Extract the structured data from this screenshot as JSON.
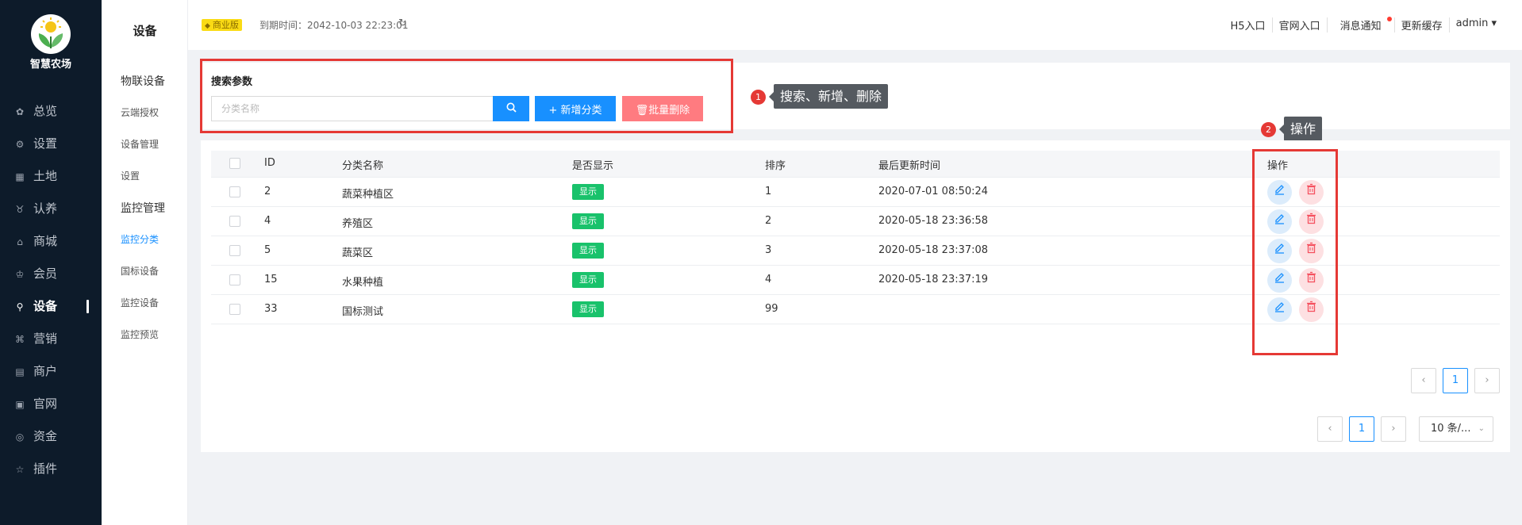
{
  "brand": {
    "name": "智慧农场"
  },
  "nav": [
    {
      "icon": "gear-flower-icon",
      "glyph": "✿",
      "label": "总览"
    },
    {
      "icon": "settings-icon",
      "glyph": "⚙",
      "label": "设置"
    },
    {
      "icon": "grid-icon",
      "glyph": "▦",
      "label": "土地"
    },
    {
      "icon": "adopt-icon",
      "glyph": "♉",
      "label": "认养"
    },
    {
      "icon": "shop-icon",
      "glyph": "⌂",
      "label": "商城"
    },
    {
      "icon": "member-icon",
      "glyph": "♔",
      "label": "会员"
    },
    {
      "icon": "device-icon",
      "glyph": "⚲",
      "label": "设备",
      "active": true
    },
    {
      "icon": "marketing-icon",
      "glyph": "⌘",
      "label": "营销"
    },
    {
      "icon": "merchant-icon",
      "glyph": "▤",
      "label": "商户"
    },
    {
      "icon": "website-icon",
      "glyph": "▣",
      "label": "官网"
    },
    {
      "icon": "funds-icon",
      "glyph": "◎",
      "label": "资金"
    },
    {
      "icon": "plugin-icon",
      "glyph": "☆",
      "label": "插件"
    }
  ],
  "subnav": {
    "title": "设备",
    "sections": [
      {
        "label": "物联设备",
        "items": [
          "云端授权",
          "设备管理",
          "设置"
        ]
      },
      {
        "label": "监控管理",
        "items": [
          "监控分类",
          "国标设备",
          "监控设备",
          "监控预览"
        ]
      }
    ],
    "active": "监控分类"
  },
  "header": {
    "badge": "商业版",
    "expire": "到期时间：2042-10-03 22:23:01",
    "links": [
      "H5入口",
      "官网入口",
      "消息通知",
      "更新缓存",
      "admin ▾"
    ]
  },
  "search": {
    "title": "搜索参数",
    "placeholder": "分类名称",
    "add_label": "+ 新增分类",
    "batch_delete_label": "🗑批量删除"
  },
  "annotations": [
    {
      "num": "1",
      "text": "搜索、新增、删除"
    },
    {
      "num": "2",
      "text": "操作"
    }
  ],
  "table": {
    "columns": [
      "ID",
      "分类名称",
      "是否显示",
      "排序",
      "最后更新时间",
      "操作"
    ],
    "rows": [
      {
        "id": "2",
        "name": "蔬菜种植区",
        "show": "显示",
        "sort": "1",
        "updated": "2020-07-01 08:50:24"
      },
      {
        "id": "4",
        "name": "养殖区",
        "show": "显示",
        "sort": "2",
        "updated": "2020-05-18 23:36:58"
      },
      {
        "id": "5",
        "name": "蔬菜区",
        "show": "显示",
        "sort": "3",
        "updated": "2020-05-18 23:37:08"
      },
      {
        "id": "15",
        "name": "水果种植",
        "show": "显示",
        "sort": "4",
        "updated": "2020-05-18 23:37:19"
      },
      {
        "id": "33",
        "name": "国标测试",
        "show": "显示",
        "sort": "99",
        "updated": ""
      }
    ]
  },
  "pagination": {
    "current": "1",
    "page_size": "10 条/..."
  },
  "colors": {
    "primary": "#1890ff",
    "danger": "#ff7b80",
    "success": "#19c26b",
    "sidebar": "#0d1b2a",
    "annotation": "#e53935"
  }
}
